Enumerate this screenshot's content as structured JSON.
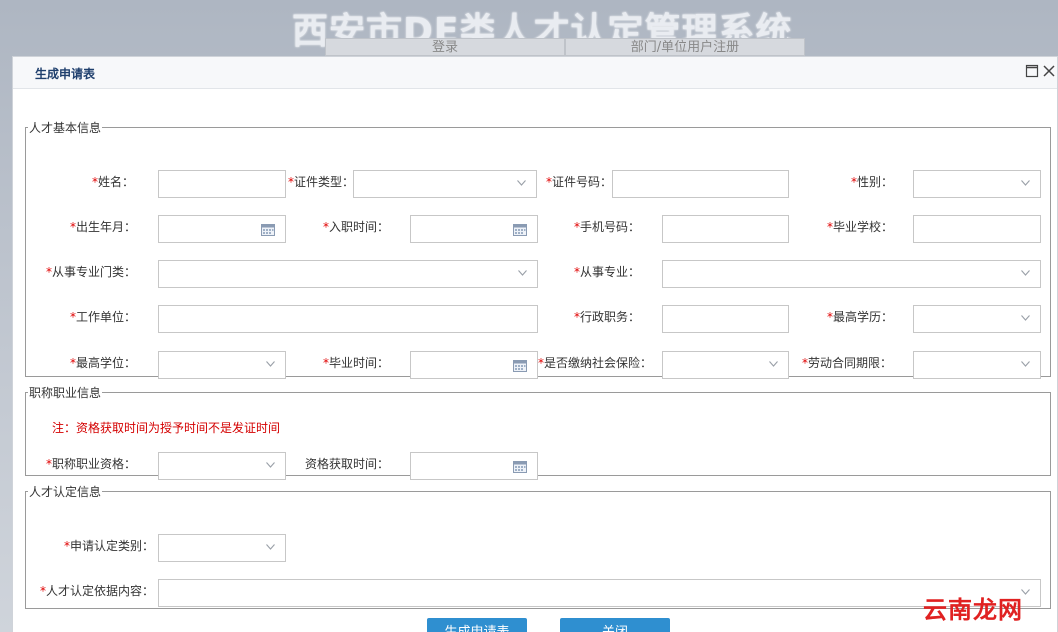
{
  "background": {
    "title": "西安市DE类人才认定管理系统",
    "tabs": [
      "登录",
      "部门/单位用户注册"
    ]
  },
  "dialog": {
    "title": "生成申请表"
  },
  "sections": {
    "basic": {
      "legend": "人才基本信息",
      "labels": {
        "name": "姓名：",
        "id_type": "证件类型：",
        "id_number": "证件号码：",
        "gender": "性别：",
        "birth": "出生年月：",
        "entry": "入职时间：",
        "mobile": "手机号码：",
        "school": "毕业学校：",
        "major_category": "从事专业门类：",
        "major": "从事专业：",
        "employer": "工作单位：",
        "position": "行政职务：",
        "education": "最高学历：",
        "degree": "最高学位：",
        "grad_time": "毕业时间：",
        "social_insurance": "是否缴纳社会保险：",
        "contract_term": "劳动合同期限："
      }
    },
    "title_info": {
      "legend": "职称职业信息",
      "note": "注：资格获取时间为授予时间不是发证时间",
      "labels": {
        "qualification": "职称职业资格：",
        "acq_time": "资格获取时间："
      }
    },
    "recognition": {
      "legend": "人才认定信息",
      "labels": {
        "category": "申请认定类别：",
        "basis": "人才认定依据内容："
      }
    }
  },
  "buttons": {
    "generate": "生成申请表",
    "close": "关闭"
  },
  "required_mark": "*",
  "watermark": "云南龙网",
  "icons": {
    "dropdown": "chevron-down-icon",
    "calendar": "calendar-icon",
    "maximize": "maximize-icon",
    "close": "close-icon"
  },
  "colors": {
    "required": "#e00000",
    "accent_button": "#2f8fd0",
    "dialog_title": "#1f3f6d"
  }
}
